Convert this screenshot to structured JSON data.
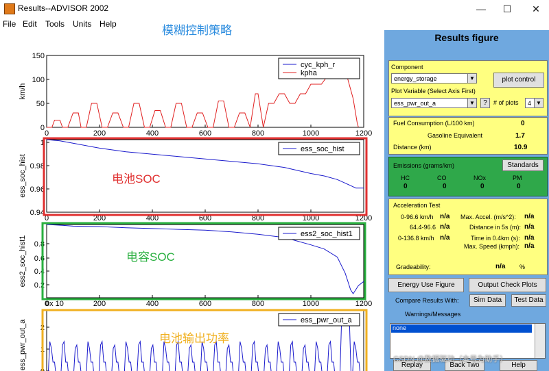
{
  "window": {
    "title": "Results--ADVISOR 2002",
    "minimize": "—",
    "maximize": "☐",
    "close": "✕"
  },
  "menu": [
    "File",
    "Edit",
    "Tools",
    "Units",
    "Help"
  ],
  "annotations": {
    "top": "模糊控制策略",
    "battery_soc": "电池SOC",
    "capacitor_soc": "电容SOC",
    "battery_power": "电池输出功率"
  },
  "plots": [
    {
      "ylabel": "km/h",
      "yticks": [
        "150",
        "100",
        "50",
        "0"
      ],
      "xticks": [
        "0",
        "200",
        "400",
        "600",
        "800",
        "1000",
        "1200"
      ],
      "legend": [
        "cyc_kph_r",
        "kpha"
      ]
    },
    {
      "ylabel": "ess_soc_hist",
      "yticks": [
        "1",
        "0.98",
        "0.96",
        "0.94"
      ],
      "xticks": [
        "0",
        "200",
        "400",
        "600",
        "800",
        "1000",
        "1200"
      ],
      "legend": [
        "ess_soc_hist"
      ]
    },
    {
      "ylabel": "ess2_soc_hist1",
      "yticks": [
        "0.8",
        "0.6",
        "0.4",
        "0.2"
      ],
      "xticks": [
        "0",
        "200",
        "400",
        "600",
        "800",
        "1000",
        "1200"
      ],
      "legend": [
        "ess2_soc_hist1"
      ],
      "corner": "0x 10"
    },
    {
      "ylabel": "ess_pwr_out_a",
      "yticks": [
        "2",
        "1",
        "0"
      ],
      "legend": [
        "ess_pwr_out_a"
      ]
    }
  ],
  "chart_data": [
    {
      "type": "line",
      "xlim": [
        0,
        1200
      ],
      "ylim": [
        0,
        150
      ],
      "series": [
        {
          "name": "cyc_kph_r",
          "color": "#1a1acc"
        },
        {
          "name": "kpha",
          "color": "#e02020",
          "x": [
            0,
            20,
            30,
            50,
            60,
            80,
            100,
            120,
            130,
            150,
            170,
            190,
            210,
            230,
            250,
            270,
            290,
            310,
            330,
            350,
            370,
            390,
            410,
            430,
            450,
            470,
            490,
            510,
            530,
            550,
            570,
            590,
            610,
            630,
            650,
            670,
            690,
            710,
            730,
            750,
            770,
            790,
            800,
            820,
            840,
            860,
            880,
            900,
            920,
            940,
            960,
            980,
            1000,
            1020,
            1040,
            1060,
            1080,
            1100,
            1120,
            1140,
            1160,
            1175,
            1180
          ],
          "y": [
            0,
            0,
            15,
            15,
            0,
            0,
            30,
            30,
            0,
            0,
            50,
            50,
            0,
            0,
            30,
            30,
            0,
            0,
            50,
            50,
            0,
            0,
            35,
            35,
            0,
            0,
            50,
            50,
            0,
            0,
            30,
            30,
            0,
            0,
            55,
            55,
            0,
            0,
            30,
            30,
            0,
            70,
            70,
            0,
            50,
            50,
            70,
            70,
            50,
            50,
            70,
            70,
            90,
            90,
            90,
            105,
            105,
            115,
            115,
            100,
            60,
            10,
            0
          ]
        }
      ]
    },
    {
      "type": "line",
      "xlim": [
        0,
        1200
      ],
      "ylim": [
        0.94,
        1.0
      ],
      "series": [
        {
          "name": "ess_soc_hist",
          "color": "#1a1acc",
          "x": [
            0,
            50,
            100,
            200,
            300,
            400,
            500,
            600,
            700,
            800,
            900,
            1000,
            1050,
            1100,
            1130,
            1150,
            1170,
            1200
          ],
          "y": [
            1.0,
            0.999,
            0.997,
            0.993,
            0.99,
            0.988,
            0.986,
            0.984,
            0.982,
            0.98,
            0.977,
            0.972,
            0.97,
            0.967,
            0.964,
            0.962,
            0.96,
            0.96
          ]
        }
      ]
    },
    {
      "type": "line",
      "xlim": [
        0,
        1200
      ],
      "ylim": [
        0,
        0.9
      ],
      "series": [
        {
          "name": "ess2_soc_hist1",
          "color": "#1a1acc",
          "x": [
            0,
            60,
            100,
            200,
            300,
            400,
            500,
            600,
            700,
            800,
            900,
            1000,
            1050,
            1100,
            1130,
            1150,
            1160,
            1180,
            1200
          ],
          "y": [
            0.9,
            0.89,
            0.88,
            0.875,
            0.86,
            0.85,
            0.84,
            0.83,
            0.81,
            0.78,
            0.74,
            0.65,
            0.6,
            0.5,
            0.3,
            0.1,
            0.05,
            0.15,
            0.2
          ]
        }
      ]
    },
    {
      "type": "line",
      "xlim": [
        0,
        1200
      ],
      "ylim": [
        0,
        2
      ],
      "series": [
        {
          "name": "ess_pwr_out_a",
          "color": "#1a1acc"
        }
      ]
    }
  ],
  "panel": {
    "title": "Results figure",
    "component_label": "Component",
    "component_value": "energy_storage",
    "plot_control": "plot control",
    "plot_var_label": "Plot Variable (Select Axis First)",
    "plot_var_value": "ess_pwr_out_a",
    "help_q": "?",
    "num_plots_label": "# of plots",
    "num_plots_value": "4",
    "fuel_label": "Fuel Consumption (L/100 km)",
    "fuel_value": "0",
    "gas_label": "Gasoline Equivalent",
    "gas_value": "1.7",
    "dist_label": "Distance (km)",
    "dist_value": "10.9",
    "emissions_label": "Emissions (grams/km)",
    "standards": "Standards",
    "em_names": [
      "HC",
      "CO",
      "NOx",
      "PM"
    ],
    "em_values": [
      "0",
      "0",
      "0",
      "0"
    ],
    "accel_label": "Acceleration Test",
    "accel_rows": [
      {
        "l": "0-96.6 km/h",
        "lv": "n/a",
        "r": "Max. Accel. (m/s^2):",
        "rv": "n/a"
      },
      {
        "l": "64.4-96.6",
        "lv": "n/a",
        "r": "Distance in 5s (m):",
        "rv": "n/a"
      },
      {
        "l": "0-136.8 km/h",
        "lv": "n/a",
        "r": "Time in 0.4km (s):",
        "rv": "n/a"
      },
      {
        "l": "",
        "lv": "",
        "r": "Max. Speed (kmph):",
        "rv": "n/a"
      }
    ],
    "grade_label": "Gradeability:",
    "grade_value": "n/a",
    "grade_unit": "%",
    "energy_use": "Energy Use Figure",
    "output_check": "Output Check Plots",
    "compare_label": "Compare Results With:",
    "sim_data": "Sim Data",
    "test_data": "Test Data",
    "warnings_label": "Warnings/Messages",
    "warning_item": "none",
    "replay": "Replay",
    "back_two": "Back Two",
    "help": "Help"
  },
  "watermark": "CSDN @数据驱动（本号为助手）",
  "colors": {
    "red_box": "#e03030",
    "green_box": "#2ab040",
    "orange_box": "#f0b020",
    "panel": "#6fa8df"
  }
}
